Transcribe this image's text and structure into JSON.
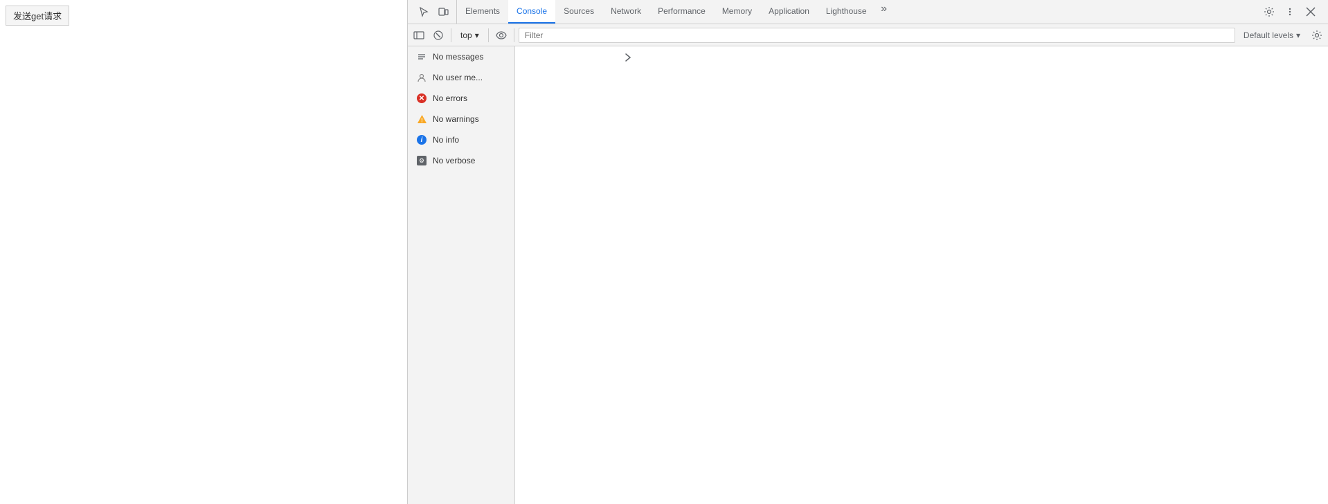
{
  "page": {
    "button_label": "发送get请求"
  },
  "devtools": {
    "tabs": [
      {
        "id": "elements",
        "label": "Elements",
        "active": false
      },
      {
        "id": "console",
        "label": "Console",
        "active": true
      },
      {
        "id": "sources",
        "label": "Sources",
        "active": false
      },
      {
        "id": "network",
        "label": "Network",
        "active": false
      },
      {
        "id": "performance",
        "label": "Performance",
        "active": false
      },
      {
        "id": "memory",
        "label": "Memory",
        "active": false
      },
      {
        "id": "application",
        "label": "Application",
        "active": false
      },
      {
        "id": "lighthouse",
        "label": "Lighthouse",
        "active": false
      }
    ],
    "more_tabs_label": "»",
    "toolbar": {
      "context_value": "top",
      "filter_placeholder": "Filter",
      "levels_label": "Default levels",
      "levels_arrow": "▾"
    },
    "sidebar": {
      "items": [
        {
          "id": "all",
          "label": "No messages",
          "icon_type": "messages"
        },
        {
          "id": "user",
          "label": "No user me...",
          "icon_type": "user"
        },
        {
          "id": "errors",
          "label": "No errors",
          "icon_type": "error"
        },
        {
          "id": "warnings",
          "label": "No warnings",
          "icon_type": "warning"
        },
        {
          "id": "info",
          "label": "No info",
          "icon_type": "info"
        },
        {
          "id": "verbose",
          "label": "No verbose",
          "icon_type": "verbose"
        }
      ]
    },
    "chevron": "›"
  }
}
